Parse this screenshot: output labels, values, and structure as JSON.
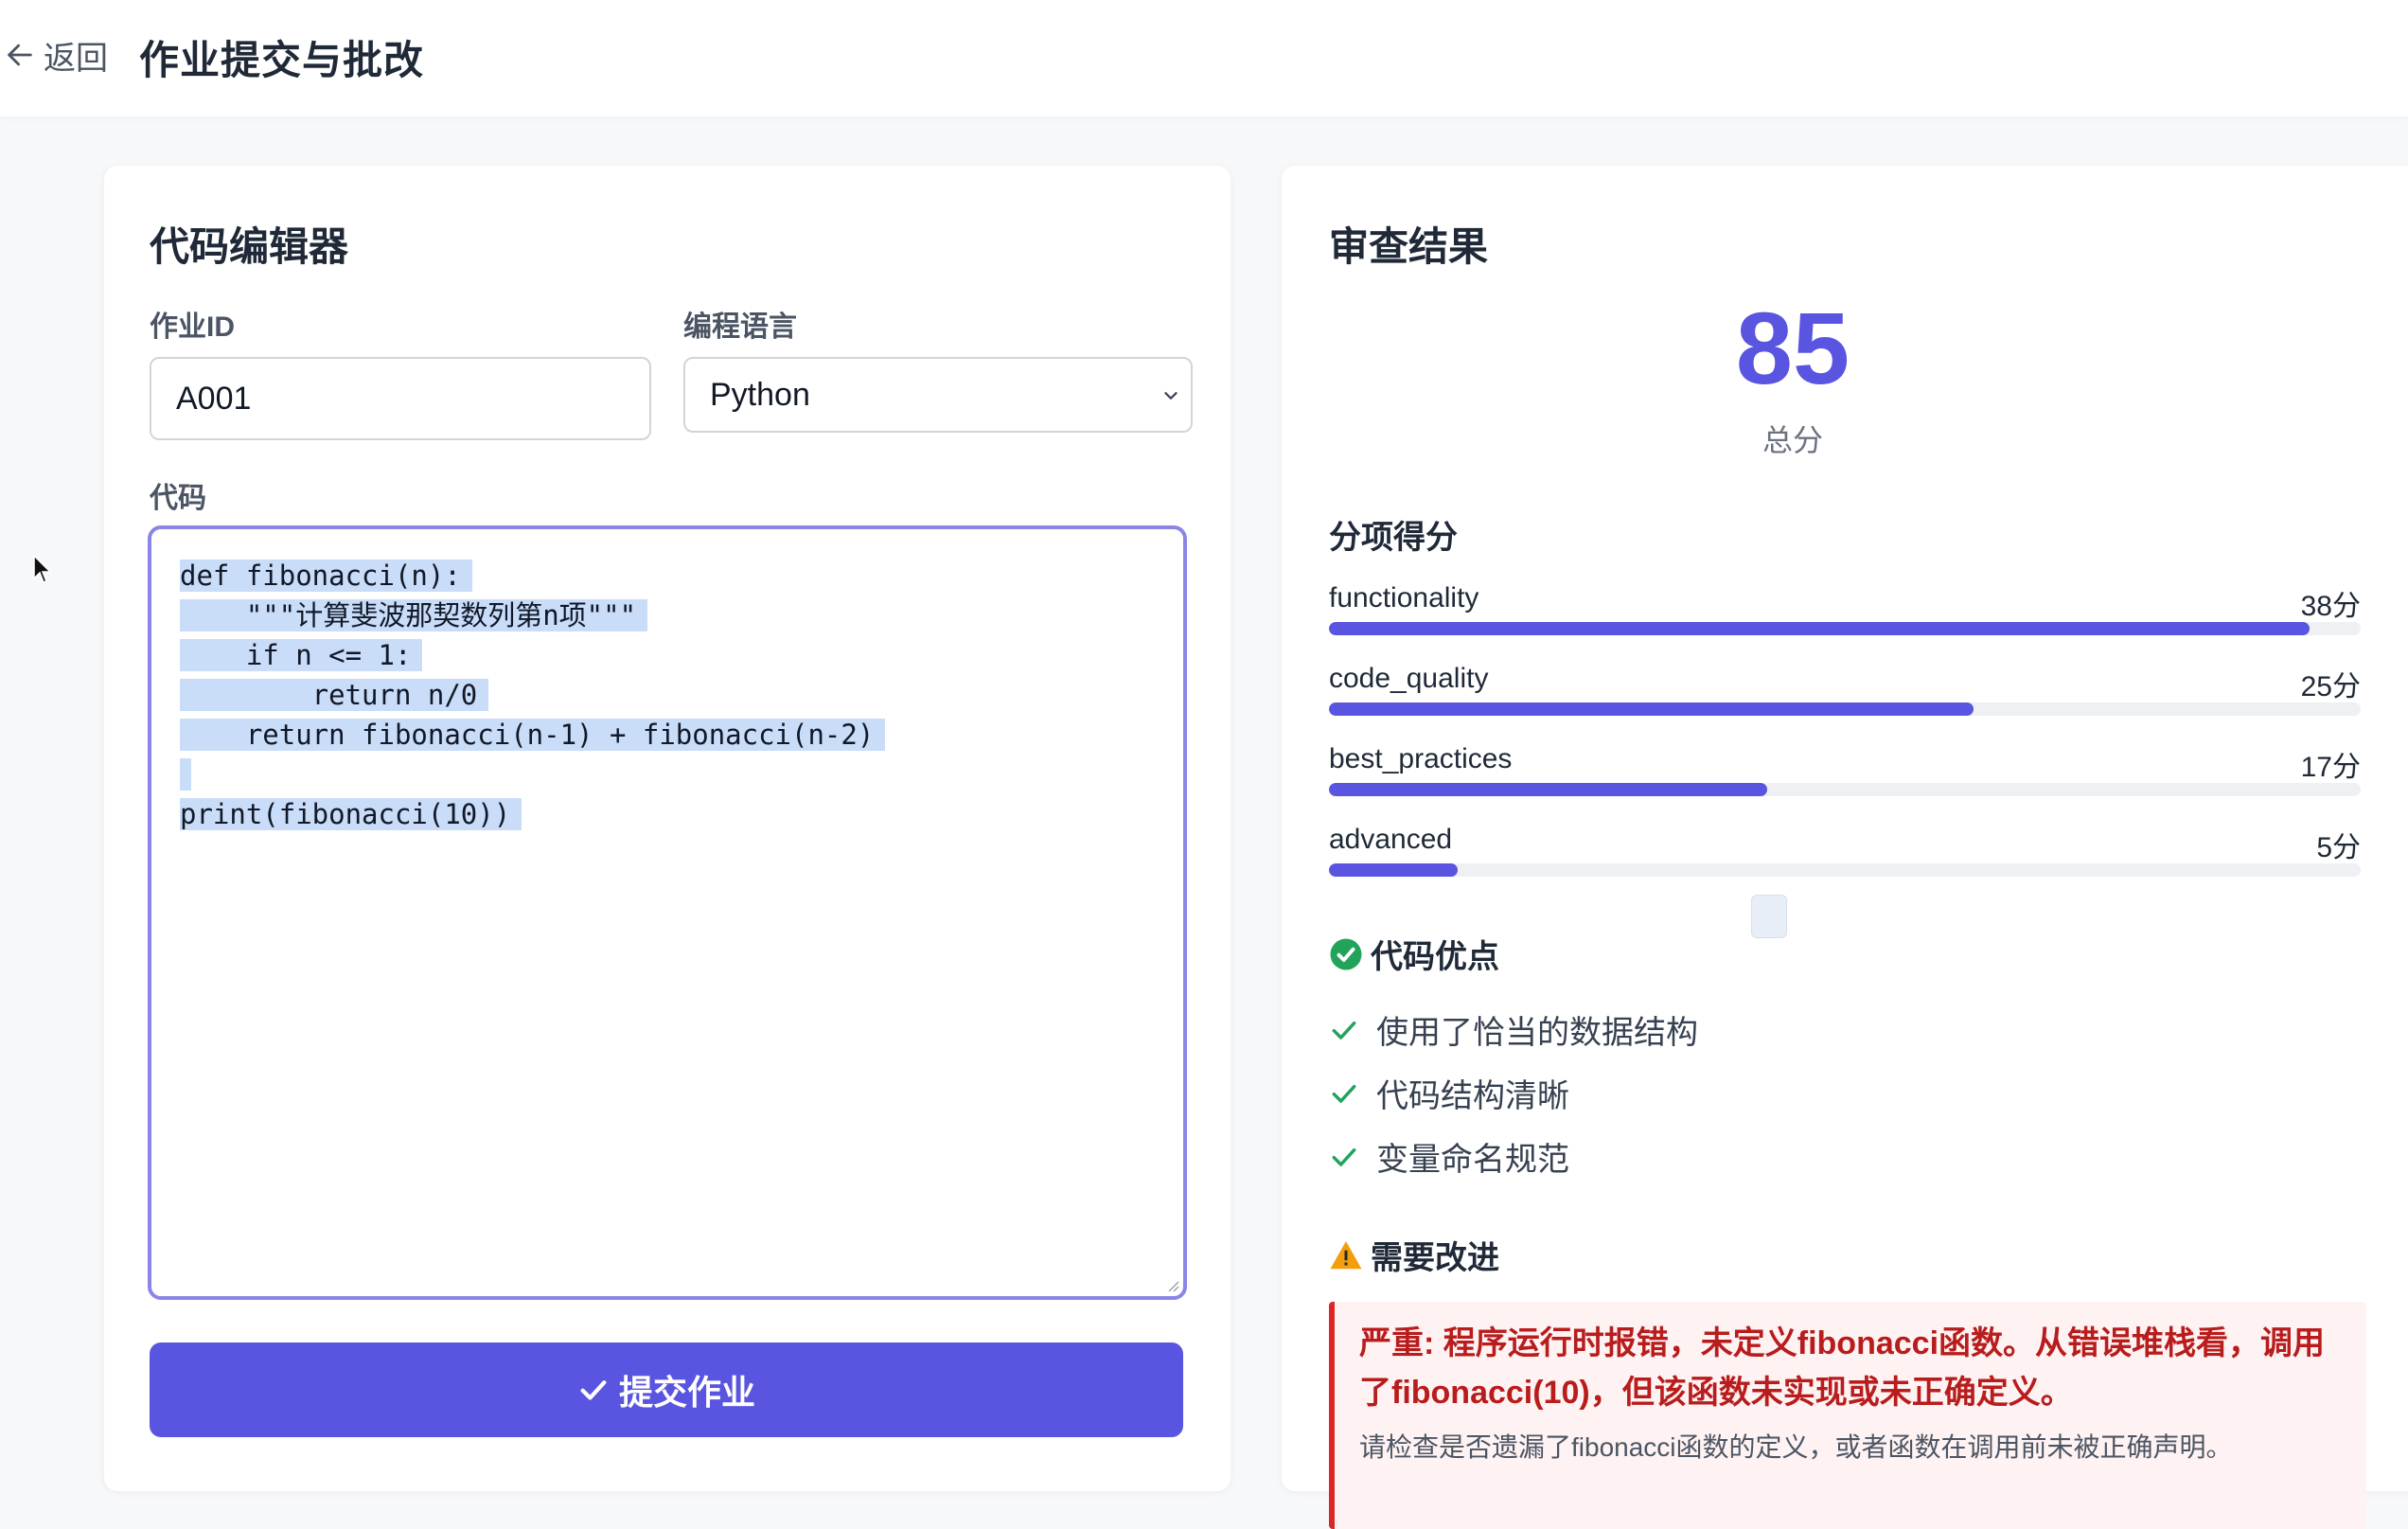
{
  "header": {
    "back_label": "返回",
    "title": "作业提交与批改"
  },
  "editor_card": {
    "title": "代码编辑器",
    "assignment_id_label": "作业ID",
    "assignment_id_value": "A001",
    "language_label": "编程语言",
    "language_value": "Python",
    "code_label": "代码",
    "code_lines": [
      "def fibonacci(n):",
      "    \"\"\"计算斐波那契数列第n项\"\"\"",
      "    if n <= 1:",
      "        return n/0",
      "    return fibonacci(n-1) + fibonacci(n-2)",
      "",
      "print(fibonacci(10))"
    ],
    "submit_label": "提交作业"
  },
  "review_card": {
    "title": "审查结果",
    "total_score": "85",
    "total_label": "总分",
    "breakdown_title": "分项得分",
    "breakdown": [
      {
        "name": "functionality",
        "score": "38分",
        "fraction": 0.95
      },
      {
        "name": "code_quality",
        "score": "25分",
        "fraction": 0.625
      },
      {
        "name": "best_practices",
        "score": "17分",
        "fraction": 0.425
      },
      {
        "name": "advanced",
        "score": "5分",
        "fraction": 0.125
      }
    ],
    "strengths_title": "代码优点",
    "strengths": [
      "使用了恰当的数据结构",
      "代码结构清晰",
      "变量命名规范"
    ],
    "improvements_title": "需要改进",
    "improvement_main": "严重: 程序运行时报错，未定义fibonacci函数。从错误堆栈看，调用了fibonacci(10)，但该函数未实现或未正确定义。",
    "improvement_sub": "请检查是否遗漏了fibonacci函数的定义，或者函数在调用前未被正确声明。"
  },
  "colors": {
    "accent": "#5a55e0",
    "success": "#22a35a",
    "warning": "#f59e0b",
    "danger": "#b91c1c"
  }
}
